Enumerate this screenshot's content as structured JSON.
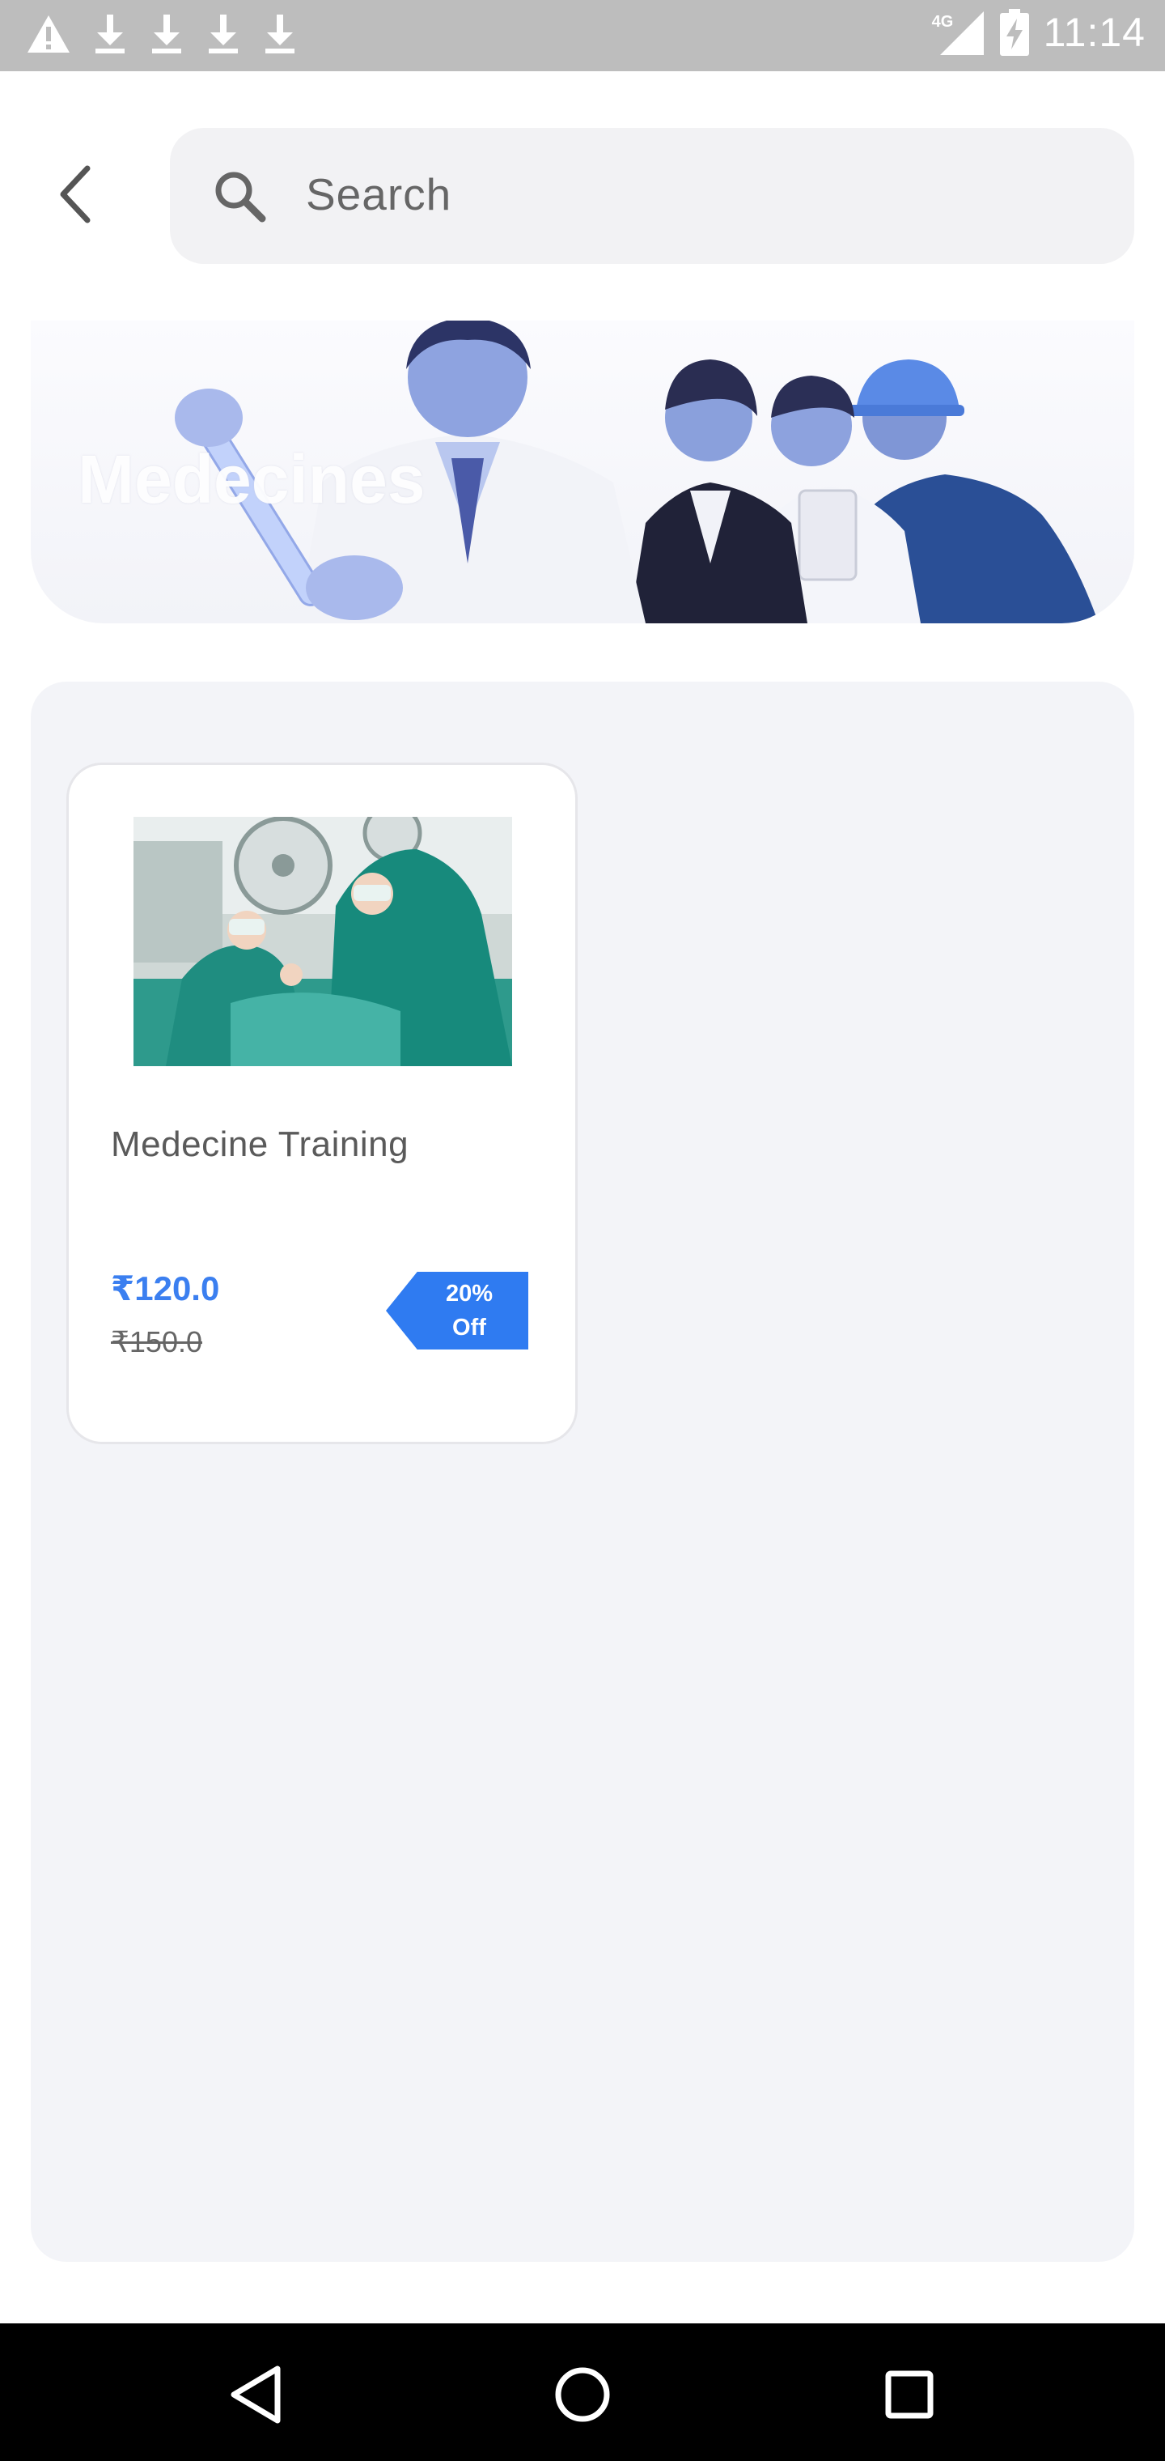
{
  "status_bar": {
    "time": "11:14",
    "network": "4G",
    "icons": [
      "warning-icon",
      "download-icon",
      "download-icon",
      "download-icon",
      "download-icon",
      "signal-icon",
      "battery-charging-icon"
    ]
  },
  "header": {
    "back_icon": "chevron-left-icon",
    "search_placeholder": "Search"
  },
  "banner": {
    "title": "Medecines"
  },
  "products": [
    {
      "title": "Medecine Training",
      "price": "₹120.0",
      "original_price": "₹150.0",
      "discount": "20%\nOff"
    }
  ],
  "colors": {
    "accent": "#3b7ff0",
    "badge": "#2f7bf1",
    "panel": "#f3f4f8",
    "status_bar": "#bdbdbd",
    "nav_bar": "#000000"
  },
  "nav_bar": {
    "icons": [
      "back-triangle-icon",
      "home-circle-icon",
      "recents-square-icon"
    ]
  }
}
